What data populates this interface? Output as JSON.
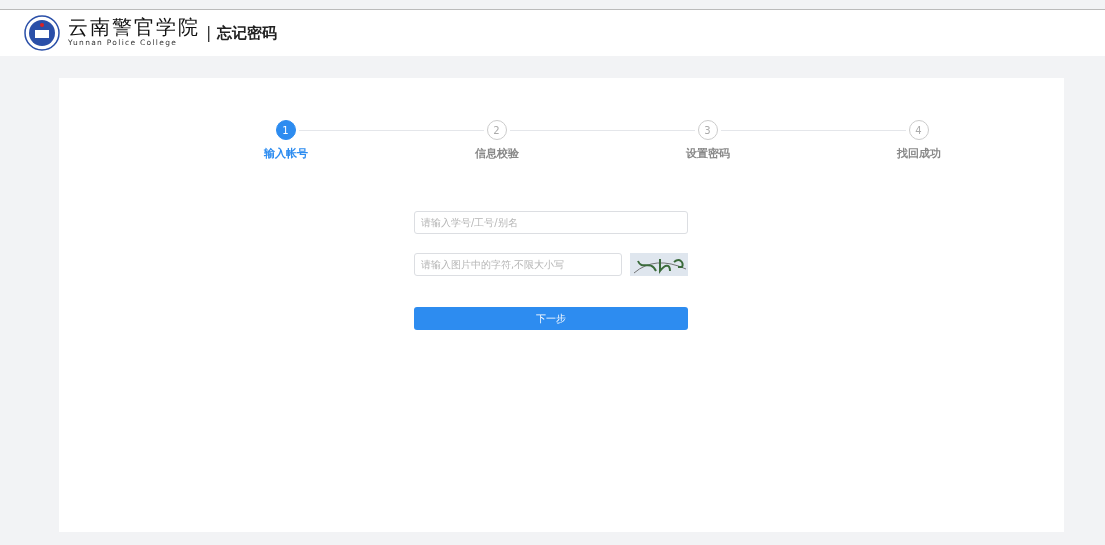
{
  "header": {
    "title": "云南警官学院",
    "subtitle": "Yunnan Police College",
    "separator": "|",
    "page_title": "忘记密码"
  },
  "steps": [
    {
      "number": "1",
      "label": "输入帐号",
      "selected": true
    },
    {
      "number": "2",
      "label": "信息校验",
      "selected": false
    },
    {
      "number": "3",
      "label": "设置密码",
      "selected": false
    },
    {
      "number": "4",
      "label": "找回成功",
      "selected": false
    }
  ],
  "form": {
    "account": {
      "placeholder": "请输入学号/工号/别名"
    },
    "captcha": {
      "placeholder": "请输入图片中的字符,不限大小写"
    },
    "submit": "下一步"
  }
}
